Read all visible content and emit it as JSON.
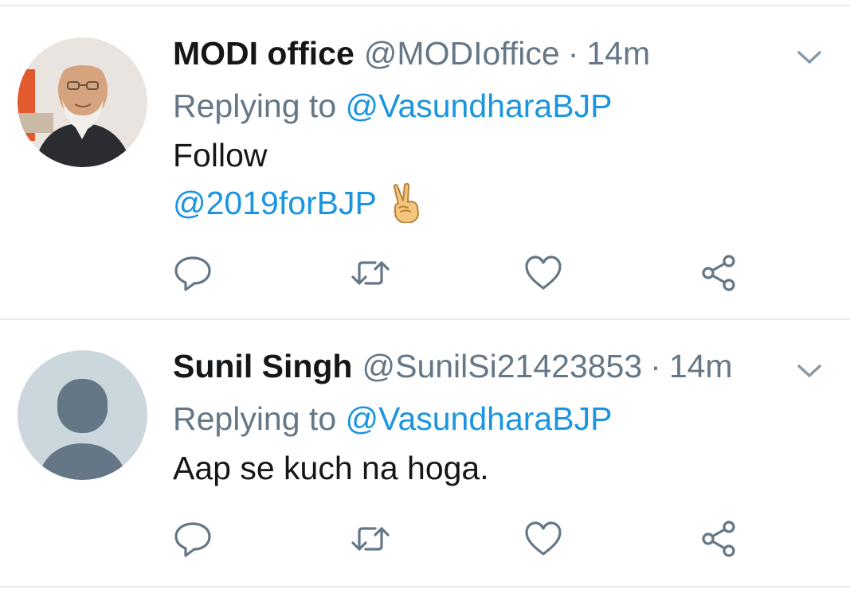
{
  "tweets": [
    {
      "author": "MODI office",
      "handle": "@MODIoffice",
      "separator": "·",
      "time": "14m",
      "replying_prefix": "Replying to",
      "replying_to": "@VasundharaBJP",
      "body_text": "Follow",
      "body_link": "@2019forBJP",
      "body_emoji": "victory-hand-emoji",
      "avatar": "profile-photo"
    },
    {
      "author": "Sunil Singh",
      "handle": "@SunilSi21423853",
      "separator": "·",
      "time": "14m",
      "replying_prefix": "Replying to",
      "replying_to": "@VasundharaBJP",
      "body_text": "Aap se kuch na hoga.",
      "avatar": "default-avatar"
    }
  ],
  "icons": {
    "reply": "reply-icon",
    "retweet": "retweet-icon",
    "like": "heart-icon",
    "share": "share-icon",
    "menu": "chevron-down-icon"
  },
  "colors": {
    "text": "#14171a",
    "muted": "#657786",
    "link": "#1b95e0",
    "icon": "#657786",
    "divider": "#e6ecf0"
  }
}
